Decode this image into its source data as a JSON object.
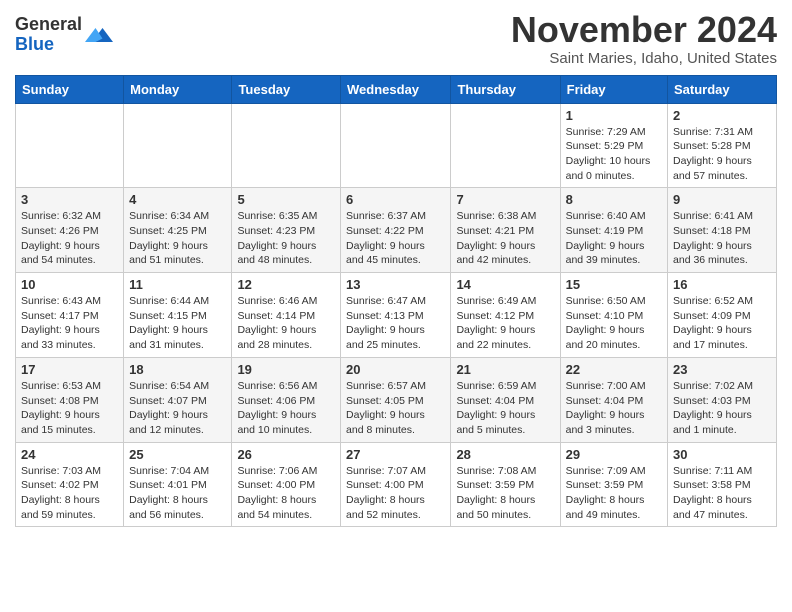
{
  "header": {
    "logo_general": "General",
    "logo_blue": "Blue",
    "month": "November 2024",
    "location": "Saint Maries, Idaho, United States"
  },
  "weekdays": [
    "Sunday",
    "Monday",
    "Tuesday",
    "Wednesday",
    "Thursday",
    "Friday",
    "Saturday"
  ],
  "weeks": [
    [
      {
        "day": "",
        "info": ""
      },
      {
        "day": "",
        "info": ""
      },
      {
        "day": "",
        "info": ""
      },
      {
        "day": "",
        "info": ""
      },
      {
        "day": "",
        "info": ""
      },
      {
        "day": "1",
        "info": "Sunrise: 7:29 AM\nSunset: 5:29 PM\nDaylight: 10 hours\nand 0 minutes."
      },
      {
        "day": "2",
        "info": "Sunrise: 7:31 AM\nSunset: 5:28 PM\nDaylight: 9 hours\nand 57 minutes."
      }
    ],
    [
      {
        "day": "3",
        "info": "Sunrise: 6:32 AM\nSunset: 4:26 PM\nDaylight: 9 hours\nand 54 minutes."
      },
      {
        "day": "4",
        "info": "Sunrise: 6:34 AM\nSunset: 4:25 PM\nDaylight: 9 hours\nand 51 minutes."
      },
      {
        "day": "5",
        "info": "Sunrise: 6:35 AM\nSunset: 4:23 PM\nDaylight: 9 hours\nand 48 minutes."
      },
      {
        "day": "6",
        "info": "Sunrise: 6:37 AM\nSunset: 4:22 PM\nDaylight: 9 hours\nand 45 minutes."
      },
      {
        "day": "7",
        "info": "Sunrise: 6:38 AM\nSunset: 4:21 PM\nDaylight: 9 hours\nand 42 minutes."
      },
      {
        "day": "8",
        "info": "Sunrise: 6:40 AM\nSunset: 4:19 PM\nDaylight: 9 hours\nand 39 minutes."
      },
      {
        "day": "9",
        "info": "Sunrise: 6:41 AM\nSunset: 4:18 PM\nDaylight: 9 hours\nand 36 minutes."
      }
    ],
    [
      {
        "day": "10",
        "info": "Sunrise: 6:43 AM\nSunset: 4:17 PM\nDaylight: 9 hours\nand 33 minutes."
      },
      {
        "day": "11",
        "info": "Sunrise: 6:44 AM\nSunset: 4:15 PM\nDaylight: 9 hours\nand 31 minutes."
      },
      {
        "day": "12",
        "info": "Sunrise: 6:46 AM\nSunset: 4:14 PM\nDaylight: 9 hours\nand 28 minutes."
      },
      {
        "day": "13",
        "info": "Sunrise: 6:47 AM\nSunset: 4:13 PM\nDaylight: 9 hours\nand 25 minutes."
      },
      {
        "day": "14",
        "info": "Sunrise: 6:49 AM\nSunset: 4:12 PM\nDaylight: 9 hours\nand 22 minutes."
      },
      {
        "day": "15",
        "info": "Sunrise: 6:50 AM\nSunset: 4:10 PM\nDaylight: 9 hours\nand 20 minutes."
      },
      {
        "day": "16",
        "info": "Sunrise: 6:52 AM\nSunset: 4:09 PM\nDaylight: 9 hours\nand 17 minutes."
      }
    ],
    [
      {
        "day": "17",
        "info": "Sunrise: 6:53 AM\nSunset: 4:08 PM\nDaylight: 9 hours\nand 15 minutes."
      },
      {
        "day": "18",
        "info": "Sunrise: 6:54 AM\nSunset: 4:07 PM\nDaylight: 9 hours\nand 12 minutes."
      },
      {
        "day": "19",
        "info": "Sunrise: 6:56 AM\nSunset: 4:06 PM\nDaylight: 9 hours\nand 10 minutes."
      },
      {
        "day": "20",
        "info": "Sunrise: 6:57 AM\nSunset: 4:05 PM\nDaylight: 9 hours\nand 8 minutes."
      },
      {
        "day": "21",
        "info": "Sunrise: 6:59 AM\nSunset: 4:04 PM\nDaylight: 9 hours\nand 5 minutes."
      },
      {
        "day": "22",
        "info": "Sunrise: 7:00 AM\nSunset: 4:04 PM\nDaylight: 9 hours\nand 3 minutes."
      },
      {
        "day": "23",
        "info": "Sunrise: 7:02 AM\nSunset: 4:03 PM\nDaylight: 9 hours\nand 1 minute."
      }
    ],
    [
      {
        "day": "24",
        "info": "Sunrise: 7:03 AM\nSunset: 4:02 PM\nDaylight: 8 hours\nand 59 minutes."
      },
      {
        "day": "25",
        "info": "Sunrise: 7:04 AM\nSunset: 4:01 PM\nDaylight: 8 hours\nand 56 minutes."
      },
      {
        "day": "26",
        "info": "Sunrise: 7:06 AM\nSunset: 4:00 PM\nDaylight: 8 hours\nand 54 minutes."
      },
      {
        "day": "27",
        "info": "Sunrise: 7:07 AM\nSunset: 4:00 PM\nDaylight: 8 hours\nand 52 minutes."
      },
      {
        "day": "28",
        "info": "Sunrise: 7:08 AM\nSunset: 3:59 PM\nDaylight: 8 hours\nand 50 minutes."
      },
      {
        "day": "29",
        "info": "Sunrise: 7:09 AM\nSunset: 3:59 PM\nDaylight: 8 hours\nand 49 minutes."
      },
      {
        "day": "30",
        "info": "Sunrise: 7:11 AM\nSunset: 3:58 PM\nDaylight: 8 hours\nand 47 minutes."
      }
    ]
  ]
}
